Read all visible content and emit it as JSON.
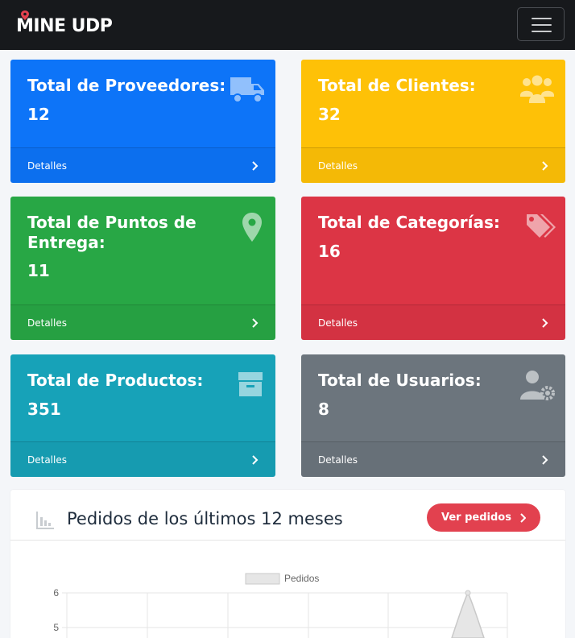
{
  "navbar": {
    "brand": "MINE UDP",
    "menu_toggle_icon": "hamburger-icon"
  },
  "cards": [
    {
      "title": "Total de Proveedores:",
      "value": "12",
      "footer": "Detalles",
      "icon": "truck-icon",
      "color": "#0d74f8"
    },
    {
      "title": "Total de Clientes:",
      "value": "32",
      "footer": "Detalles",
      "icon": "users-icon",
      "color": "#fec107"
    },
    {
      "title_line1": "Total de Puntos de",
      "title_line2": "Entrega:",
      "value": "11",
      "footer": "Detalles",
      "icon": "map-pin-icon",
      "color": "#28a745"
    },
    {
      "title": "Total de Categorías:",
      "value": "16",
      "footer": "Detalles",
      "icon": "tags-icon",
      "color": "#dc3545"
    },
    {
      "title": "Total de Productos:",
      "value": "351",
      "footer": "Detalles",
      "icon": "box-icon",
      "color": "#17a2b8"
    },
    {
      "title": "Total de Usuarios:",
      "value": "8",
      "footer": "Detalles",
      "icon": "user-gear-icon",
      "color": "#6c757d"
    }
  ],
  "orders_panel": {
    "title": "Pedidos de los últimos 12 meses",
    "button_label": "Ver pedidos",
    "header_icon": "chart-bar-icon"
  },
  "chart_data": {
    "type": "area",
    "title": "",
    "legend": [
      "Pedidos"
    ],
    "legend_position": "top",
    "grid": true,
    "y_ticks": [
      "6",
      "5"
    ],
    "ylim": [
      0,
      6
    ],
    "series": [
      {
        "name": "Pedidos",
        "peak_value": 6
      }
    ]
  }
}
